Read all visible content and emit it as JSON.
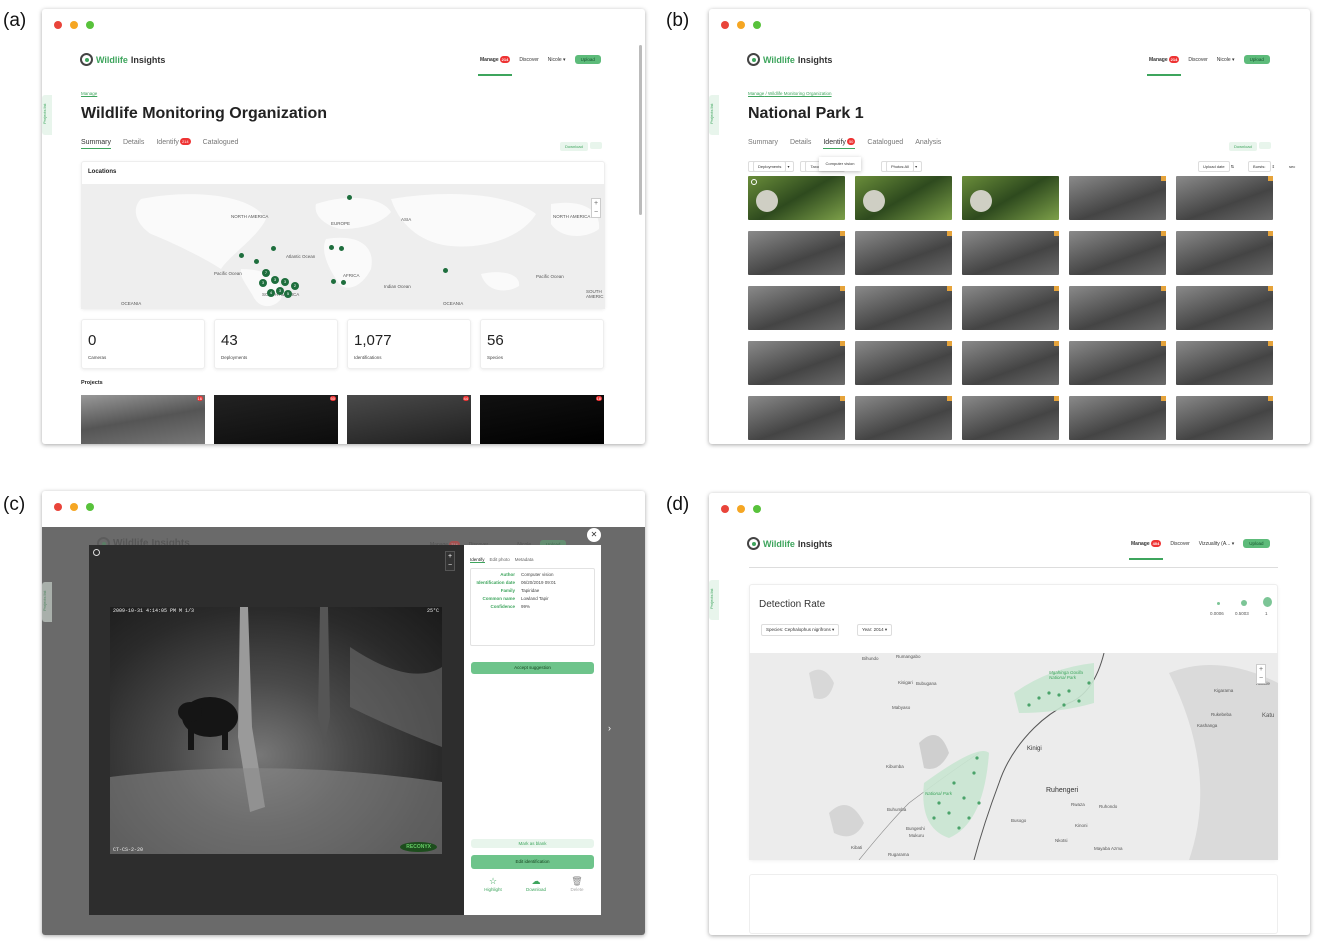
{
  "labels": {
    "a": "(a)",
    "b": "(b)",
    "c": "(c)",
    "d": "(d)"
  },
  "brand": {
    "prefix": "Wildlife",
    "suffix": " Insights"
  },
  "projects_list_tab": "Projects list",
  "panel_a": {
    "nav": {
      "manage": "Manage",
      "manage_badge": "214",
      "discover": "Discover",
      "user": "Nicole",
      "upload": "Upload"
    },
    "breadcrumb": "Manage",
    "title": "Wildlife Monitoring Organization",
    "tabs": [
      "Summary",
      "Details",
      "Identify",
      "Catalogued"
    ],
    "identify_badge": "214",
    "download": "Download",
    "locations_title": "Locations",
    "map_labels": [
      "NORTH AMERICA",
      "EUROPE",
      "ASIA",
      "NORTH AMERICA",
      "Atlantic Ocean",
      "Pacific Ocean",
      "AFRICA",
      "SOUTH AMERICA",
      "Indian Ocean",
      "Pacific Ocean",
      "OCEANIA",
      "OCEANIA",
      "SOUTH AMERIC"
    ],
    "cluster_counts": [
      "7",
      "3",
      "3",
      "3",
      "2",
      "4",
      "3",
      "5"
    ],
    "stats": [
      {
        "value": "0",
        "label": "Cameras"
      },
      {
        "value": "43",
        "label": "Deployments"
      },
      {
        "value": "1,077",
        "label": "Identifications"
      },
      {
        "value": "56",
        "label": "Species"
      }
    ],
    "projects_heading": "Projects",
    "project_badges": [
      "16",
      "50",
      "44",
      "18"
    ]
  },
  "panel_b": {
    "nav": {
      "manage": "Manage",
      "manage_badge": "214",
      "discover": "Discover",
      "user": "Nicole",
      "upload": "Upload"
    },
    "breadcrumb": [
      "Manage",
      "Wildlife Monitoring Organization"
    ],
    "title": "National Park 1",
    "tabs": [
      "Summary",
      "Details",
      "Identify",
      "Catalogued",
      "Analysis"
    ],
    "identify_badge": "50",
    "download": "Download",
    "filters": [
      "Deployments",
      "Taxonomies",
      "Photos:All"
    ],
    "dropdown_item": "Computer vision",
    "sort": {
      "label": "Upload date",
      "bursts": "Bursts:",
      "sec": "sec"
    }
  },
  "panel_c": {
    "nav": {
      "manage": "Manage",
      "manage_badge": "214",
      "discover": "Discover",
      "user": "Nicole",
      "upload": "Upload"
    },
    "photo_header": {
      "datetime": "2009-10-31  4:14:05 PM  M 1/3",
      "temp": "25°C"
    },
    "photo_footer": "CT-CS-2-20",
    "camera_brand": "RECONYX",
    "tabs": [
      "Identify",
      "Edit photo",
      "Metadata"
    ],
    "fields": [
      {
        "k": "Author",
        "v": "Computer vision"
      },
      {
        "k": "Identification date",
        "v": "06/20/2019 09:01"
      },
      {
        "k": "Family",
        "v": "Tapiridae"
      },
      {
        "k": "Common name",
        "v": "Lowland Tapir"
      },
      {
        "k": "Confidence",
        "v": "99%"
      }
    ],
    "accept": "Accept suggestion",
    "mark_blank": "Mark as blank",
    "edit": "Edit identification",
    "actions": [
      "Highlight",
      "Download",
      "Delete"
    ]
  },
  "panel_d": {
    "nav": {
      "manage": "Manage",
      "manage_badge": "404",
      "discover": "Discover",
      "user": "Vizzuality (A...",
      "upload": "Upload"
    },
    "card_title": "Detection Rate",
    "legend": [
      "0.0006",
      "0.5003",
      "1"
    ],
    "species_select": "Species: Cephalophus nigrifrons",
    "year_select": "Year: 2014",
    "places": [
      "Bihundo",
      "Rumangabo",
      "Kisigari",
      "Bubugana",
      "Mabyaso",
      "Mgahinga Gorilla National Park",
      "Kinigi",
      "Kibumba",
      "Ruhengeri",
      "Rwaza",
      "Ruhondo",
      "Buhumba",
      "National Park",
      "Busogo",
      "Bungeshi",
      "Mukuru",
      "Kinoni",
      "Nkotsi",
      "Kibati",
      "Rugarama",
      "Mayaba Azma",
      "Kigarama",
      "Rukebeba",
      "Kashanga",
      "Kabale",
      "Katu"
    ]
  }
}
